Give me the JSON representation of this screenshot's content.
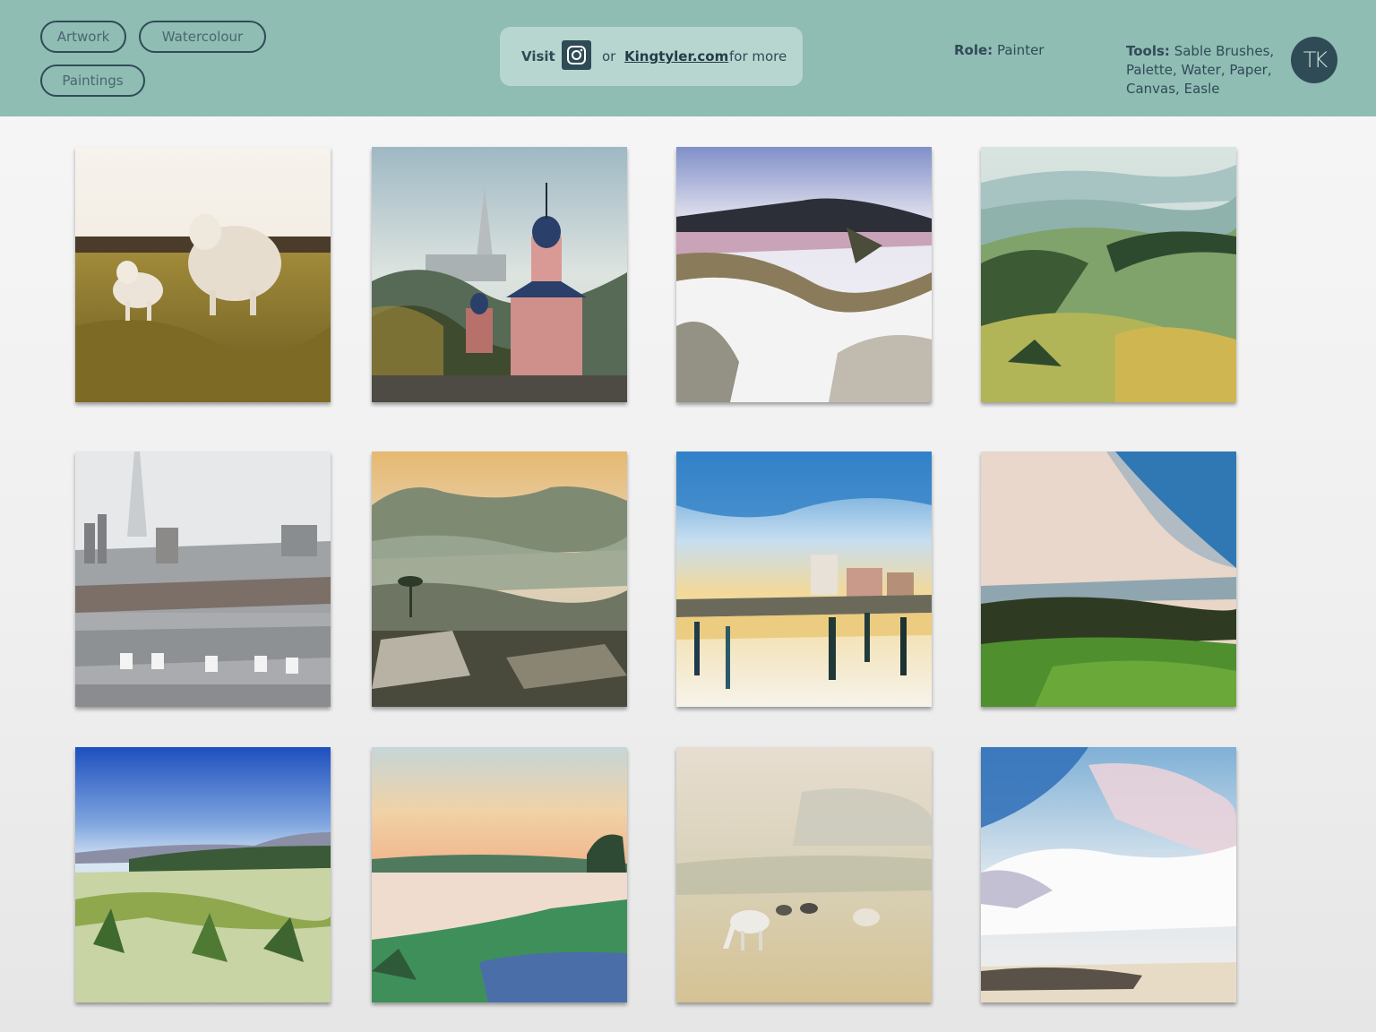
{
  "header": {
    "tags": [
      "Artwork",
      "Watercolour",
      "Paintings"
    ],
    "visit": {
      "visit_label": "Visit",
      "or_label": "or",
      "site_label": "Kingtyler.com",
      "more_label": "for more"
    },
    "role": {
      "label": "Role:",
      "value": "Painter"
    },
    "tools": {
      "label": "Tools:",
      "value": "Sable Brushes, Palette, Water, Paper, Canvas, Easle"
    },
    "logo_text": "TK"
  },
  "gallery": {
    "paintings": [
      "sheep-and-lamb-field",
      "church-tower-cityscape",
      "snowy-hills-landscape",
      "green-valley-hills",
      "paris-rooftops-eiffel-tower",
      "misty-mountain-town",
      "harbour-reflection",
      "clouds-over-green-field",
      "blue-sky-meadow",
      "sunset-river-marsh",
      "grazing-horses-mist",
      "bright-sky-clouds"
    ]
  },
  "colors": {
    "header_bg": "#8fbcb3",
    "visit_bg": "#b8d6d0",
    "accent_dark": "#2f4b56"
  }
}
